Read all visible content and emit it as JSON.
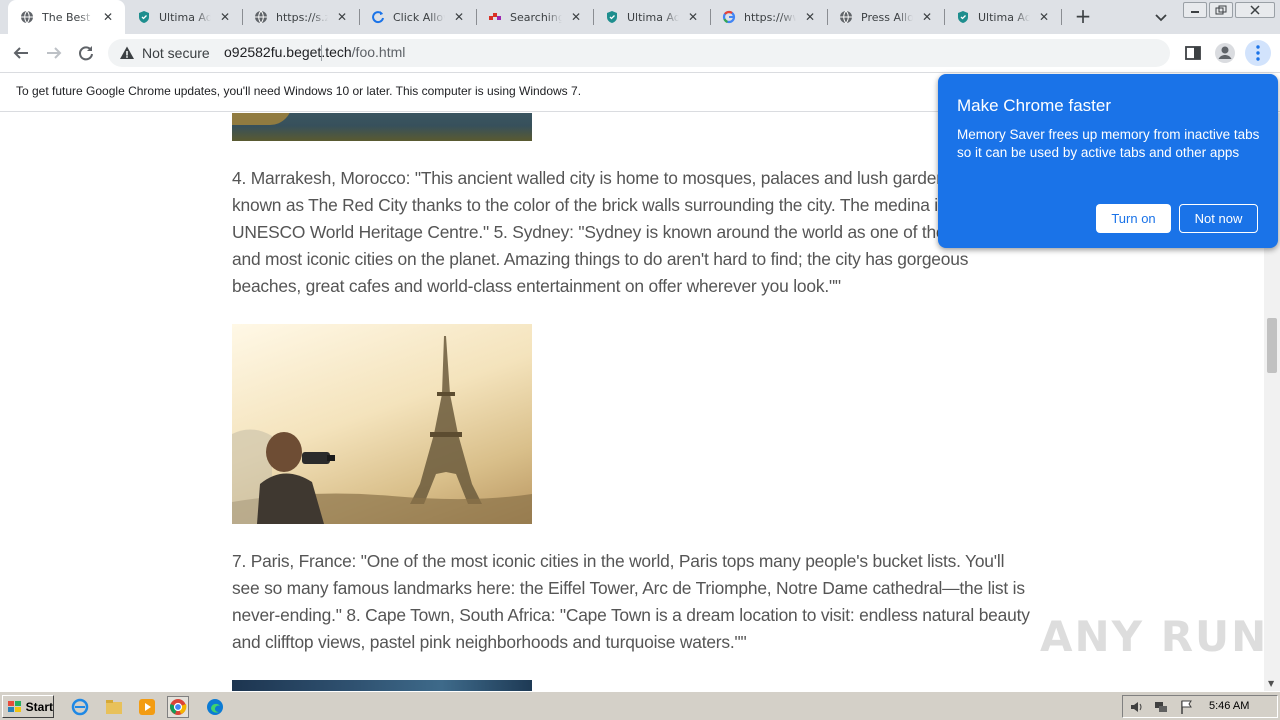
{
  "browser": {
    "tabs": [
      {
        "title": "The Best Pl",
        "icon": "globe-icon",
        "active": true
      },
      {
        "title": "Ultima AdBl",
        "icon": "shield-icon",
        "active": false
      },
      {
        "title": "https://s.zi",
        "icon": "globe-icon",
        "active": false
      },
      {
        "title": "Click Allow",
        "icon": "refresh-icon",
        "active": false
      },
      {
        "title": "Searching f",
        "icon": "dots-icon",
        "active": false
      },
      {
        "title": "Ultima AdBl",
        "icon": "shield-icon",
        "active": false
      },
      {
        "title": "https://ww",
        "icon": "google-icon",
        "active": false
      },
      {
        "title": "Press Allow",
        "icon": "globe-icon",
        "active": false
      },
      {
        "title": "Ultima AdBl",
        "icon": "shield-icon",
        "active": false
      }
    ],
    "new_tab": "+",
    "security_label": "Not secure",
    "url_host": "o92582fu.beget.tech",
    "url_path": "/foo.html"
  },
  "infobar": {
    "message": "To get future Google Chrome updates, you'll need Windows 10 or later. This computer is using Windows 7."
  },
  "content": {
    "para1": "4. Marrakesh, Morocco: \"This ancient walled city is home to mosques, palaces and lush gardens. It's known as The Red City thanks to the color of the brick walls surrounding the city. The medina is a UNESCO World Heritage Centre.\" 5. Sydney: \"Sydney is known around the world as one of the largest and most iconic cities on the planet. Amazing things to do aren't hard to find; the city has gorgeous beaches, great cafes and world-class entertainment on offer wherever you look.\"\"",
    "para2": "7. Paris, France: \"One of the most iconic cities in the world, Paris tops many people's bucket lists. You'll see so many famous landmarks here: the Eiffel Tower, Arc de Triomphe, Notre Dame cathedral—the list is never-ending.\" 8. Cape Town, South Africa: \"Cape Town is a dream location to visit: endless natural beauty and clifftop views, pastel pink neighborhoods and turquoise waters.\"\""
  },
  "popup": {
    "title": "Make Chrome faster",
    "body": "Memory Saver frees up memory from inactive tabs so it can be used by active tabs and other apps",
    "turn_on": "Turn on",
    "not_now": "Not now",
    "accent": "#1a73e8"
  },
  "watermark": "ANY RUN",
  "taskbar": {
    "start_label": "Start",
    "clock": "5:46 AM"
  }
}
